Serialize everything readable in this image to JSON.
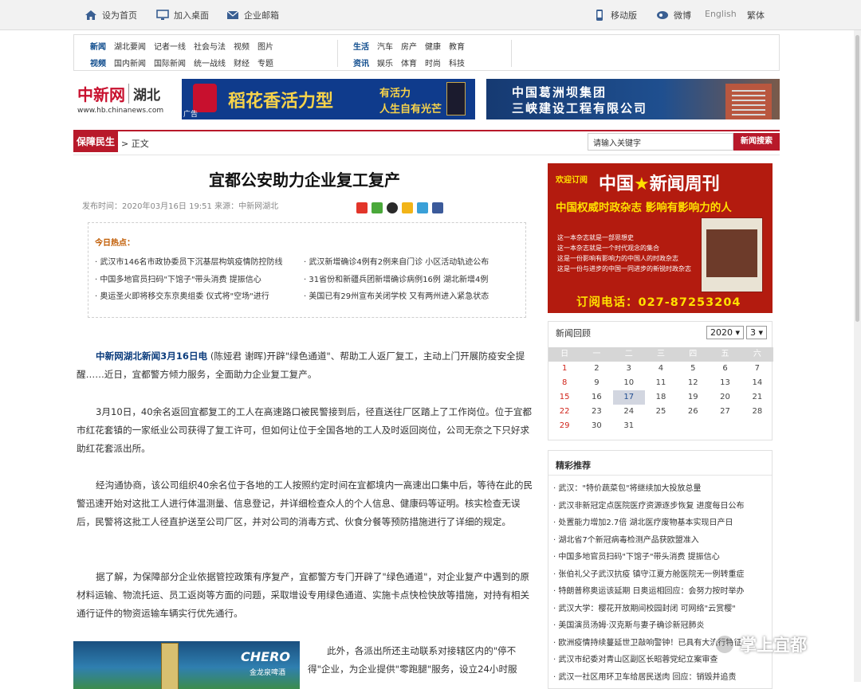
{
  "topbar": {
    "home": "设为首页",
    "desktop": "加入桌面",
    "mail": "企业邮箱",
    "mobile": "移动版",
    "weibo": "微博",
    "english": "English",
    "traditional": "繁体"
  },
  "nav": {
    "row1_left": [
      "新闻",
      "湖北要闻",
      "记者一线",
      "社会与法",
      "视频",
      "图片"
    ],
    "row2_left": [
      "视频",
      "国内新闻",
      "国际新闻",
      "统一战线",
      "财经",
      "专题"
    ],
    "row1_right": [
      "生活",
      "汽车",
      "房产",
      "健康",
      "教育"
    ],
    "row2_right": [
      "资讯",
      "娱乐",
      "体育",
      "时尚",
      "科技"
    ]
  },
  "logo": {
    "name": "中新网",
    "region": "湖北",
    "url": "www.hb.chinanews.com"
  },
  "ads": {
    "ad1_big": "稻花香活力型",
    "ad1_r1": "有活力",
    "ad1_r2": "人生自有光芒",
    "ad1_tag": "广告",
    "ad2_l1": "中国葛洲坝集团",
    "ad2_l2": "三峡建设工程有限公司"
  },
  "breadcrumb": {
    "section": "保障民生",
    "current": "> 正文"
  },
  "search": {
    "value": "请输入关键字",
    "button": "新闻搜索"
  },
  "article": {
    "title": "宜都公安助力企业复工复产",
    "meta": "发布时间：2020年03月16日 19:51 来源：中新网湖北",
    "hot_title": "今日热点：",
    "hot_items": [
      "· 武汉市146名市政协委员下沉基层构筑疫情防控防线",
      "· 武汉新增确诊4例有2例来自门诊 小区活动轨迹公布",
      "· 中国多地官员扫码\"下馆子\"带头消费 提振信心",
      "· 31省份和新疆兵团新增确诊病例16例 湖北新增4例",
      "· 奥运圣火即将移交东京奥组委 仪式将\"空场\"进行",
      "· 美国已有29州宣布关闭学校 又有两州进入紧急状态"
    ],
    "p1_lead": "中新网湖北新闻3月16日电",
    "p1_rest": " (陈娅君 谢晖)开辟\"绿色通道\"、帮助工人返厂复工，主动上门开展防疫安全提醒……近日，宜都警方倾力服务，全面助力企业复工复产。",
    "p2": "3月10日，40余名返回宜都复工的工人在高速路口被民警接到后，径直送往厂区踏上了工作岗位。位于宜都市红花套镇的一家纸业公司获得了复工许可，但如何让位于全国各地的工人及时返回岗位，公司无奈之下只好求助红花套派出所。",
    "p3": "经沟通协商，该公司组织40余名位于各地的工人按照约定时间在宜都境内一高速出口集中后，等待在此的民警迅速开始对这批工人进行体温测量、信息登记，并详细检查众人的个人信息、健康码等证明。核实检查无误后，民警将这批工人径直护送至公司厂区，并对公司的消毒方式、伙食分餐等预防措施进行了详细的规定。",
    "p4": "据了解，为保障部分企业依据管控政策有序复产，宜都警方专门开辟了\"绿色通道\"，对企业复产中遇到的原材料运输、物流托运、员工返岗等方面的问题，采取增设专用绿色通道、实施卡点快检快放等措施，对持有相关通行证件的物资运输车辆实行优先通行。",
    "p5": "此外，各派出所还主动联系对接辖区内的\"停不得\"企业，为企业提供\"零跑腿\"服务，设立24小时服",
    "photo_brand": "CHERO",
    "photo_sub": "金龙泉啤酒"
  },
  "magazine": {
    "subscribe": "欢迎订阅",
    "name_a": "中国",
    "name_b": "新闻周刊",
    "slogan": "中国权威时政杂志 影响有影响力的人",
    "bullets": [
      "这一本杂志就是一部思想史",
      "这一本杂志就是一个时代观念的集合",
      "这是一份影响有影响力的中国人的时政杂志",
      "这是一份与进步的中国一同进步的新锐时政杂志"
    ],
    "phone": "订阅电话：027-87253204"
  },
  "calendar": {
    "title": "新闻回顾",
    "year": "2020",
    "month": "3",
    "weekdays": [
      "日",
      "一",
      "二",
      "三",
      "四",
      "五",
      "六"
    ],
    "weeks": [
      [
        "1",
        "2",
        "3",
        "4",
        "5",
        "6",
        "7"
      ],
      [
        "8",
        "9",
        "10",
        "11",
        "12",
        "13",
        "14"
      ],
      [
        "15",
        "16",
        "17",
        "18",
        "19",
        "20",
        "21"
      ],
      [
        "22",
        "23",
        "24",
        "25",
        "26",
        "27",
        "28"
      ],
      [
        "29",
        "30",
        "31",
        "",
        "",
        "",
        ""
      ]
    ],
    "today": "17"
  },
  "recommend": {
    "title": "精彩推荐",
    "items": [
      "· 武汉：\"特价蔬菜包\"将继续加大投放总量",
      "· 武汉非新冠定点医院医疗资源逐步恢复 进度每日公布",
      "· 处置能力增加2.7倍 湖北医疗废物基本实现日产日",
      "· 湖北省7个新冠病毒检测产品获欧盟准入",
      "· 中国多地官员扫码\"下馆子\"带头消费 提振信心",
      "· 张伯礼父子武汉抗疫 镇守江夏方舱医院无一例转重症",
      "· 特朗普称奥运该延期 日奥运相回应：会努力按时举办",
      "· 武汉大学：樱花开放期间校园封闭 可网络\"云赏樱\"",
      "· 美国演员汤姆·汉克斯与妻子确诊新冠肺炎",
      "· 欧洲疫情持续蔓延世卫敲响警钟！已具有大流行特征",
      "· 武汉市纪委对青山区副区长昭蓉党纪立案审查",
      "· 武汉一社区用环卫车给居民送肉 回应：销毁并追责"
    ]
  },
  "watermark": "掌上宜都",
  "colors": {
    "brand_red": "#b8192a",
    "nav_blue": "#0c4a8c",
    "lead_blue": "#0c3d7d"
  }
}
